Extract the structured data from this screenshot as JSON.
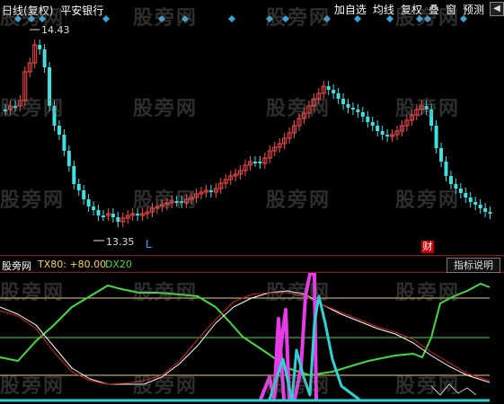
{
  "topbar": {
    "period": "日线",
    "mode": "(复权)",
    "stock_name": "平安银行",
    "buttons": [
      "加自选",
      "均线",
      "复权",
      "叠",
      "窗",
      "预测"
    ],
    "arrow_icon": "left-arrow-icon"
  },
  "watermark_text": "股旁网",
  "main_chart": {
    "high_label": "14.43",
    "low_label": "13.35",
    "marker_l": "L",
    "marker_cai": "财",
    "colors": {
      "up": "#ff4a4a",
      "down": "#3fe0e0",
      "wick": "#ff4a4a"
    }
  },
  "indicator": {
    "name": "股旁网",
    "tx_label": "TX80: +80.00",
    "dx_label": "DX20",
    "help_button": "指标说明",
    "colors": {
      "green": "#3fdc3f",
      "white": "#ffffff",
      "red": "#d22020",
      "magenta": "#e63be6",
      "cyan": "#2ed2d2"
    }
  }
}
